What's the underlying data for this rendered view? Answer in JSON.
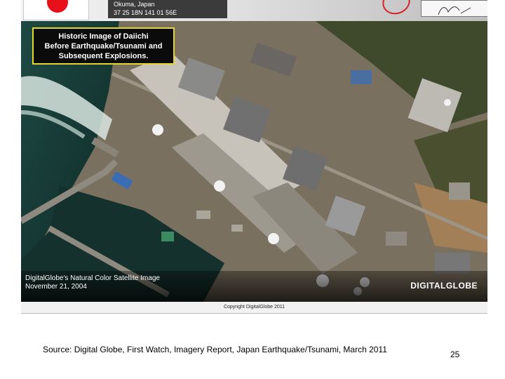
{
  "header": {
    "location_line1": "Okuma, Japan",
    "location_line2": "37 25 18N 141 01 56E"
  },
  "image": {
    "callout_line1": "Historic Image of Daiichi",
    "callout_line2": "Before Earthquake/Tsunami and",
    "callout_line3": "Subsequent Explosions.",
    "caption_line1": "DigitalGlobe's Natural Color Satellite Image",
    "caption_line2": "November 21, 2004",
    "logo_text": "DIGITALGLOBE",
    "copyright": "Copyright DigitalGlobe 2011"
  },
  "footer": {
    "source": "Source: Digital Globe, First Watch, Imagery Report, Japan Earthquake/Tsunami, March 2011",
    "page_number": "25"
  }
}
